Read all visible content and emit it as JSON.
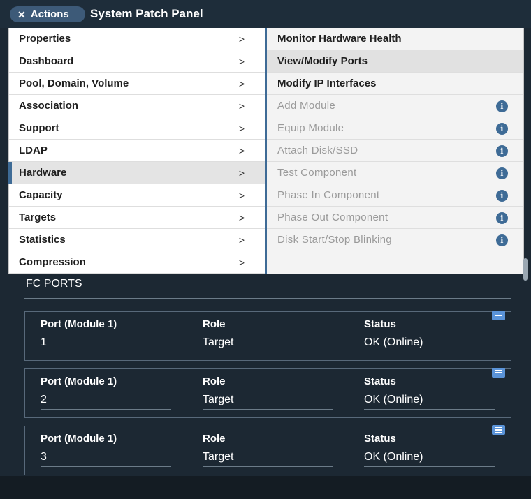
{
  "header": {
    "actions_label": "Actions",
    "close_icon": "close-icon",
    "title": "System Patch Panel"
  },
  "menu": {
    "items": [
      {
        "label": "Properties",
        "active": false
      },
      {
        "label": "Dashboard",
        "active": false
      },
      {
        "label": "Pool, Domain, Volume",
        "active": false
      },
      {
        "label": "Association",
        "active": false
      },
      {
        "label": "Support",
        "active": false
      },
      {
        "label": "LDAP",
        "active": false
      },
      {
        "label": "Hardware",
        "active": true
      },
      {
        "label": "Capacity",
        "active": false
      },
      {
        "label": "Targets",
        "active": false
      },
      {
        "label": "Statistics",
        "active": false
      },
      {
        "label": "Compression",
        "active": false
      }
    ],
    "chevron": ">",
    "submenu": [
      {
        "label": "Monitor Hardware Health",
        "enabled": true,
        "highlighted": false
      },
      {
        "label": "View/Modify Ports",
        "enabled": true,
        "highlighted": true
      },
      {
        "label": "Modify IP Interfaces",
        "enabled": true,
        "highlighted": false
      },
      {
        "label": "Add Module",
        "enabled": false,
        "highlighted": false
      },
      {
        "label": "Equip Module",
        "enabled": false,
        "highlighted": false
      },
      {
        "label": "Attach Disk/SSD",
        "enabled": false,
        "highlighted": false
      },
      {
        "label": "Test Component",
        "enabled": false,
        "highlighted": false
      },
      {
        "label": "Phase In Component",
        "enabled": false,
        "highlighted": false
      },
      {
        "label": "Phase Out Component",
        "enabled": false,
        "highlighted": false
      },
      {
        "label": "Disk Start/Stop Blinking",
        "enabled": false,
        "highlighted": false
      }
    ],
    "info_glyph": "i"
  },
  "fc_ports": {
    "title": "FC PORTS",
    "columns": [
      "Port (Module 1)",
      "Role",
      "Status"
    ],
    "rows": [
      {
        "port": "1",
        "role": "Target",
        "status": "OK (Online)"
      },
      {
        "port": "2",
        "role": "Target",
        "status": "OK (Online)"
      },
      {
        "port": "3",
        "role": "Target",
        "status": "OK (Online)"
      }
    ]
  },
  "colors": {
    "background": "#1c2833",
    "accent": "#3e6b96",
    "menu_icon": "#5a93d8"
  }
}
